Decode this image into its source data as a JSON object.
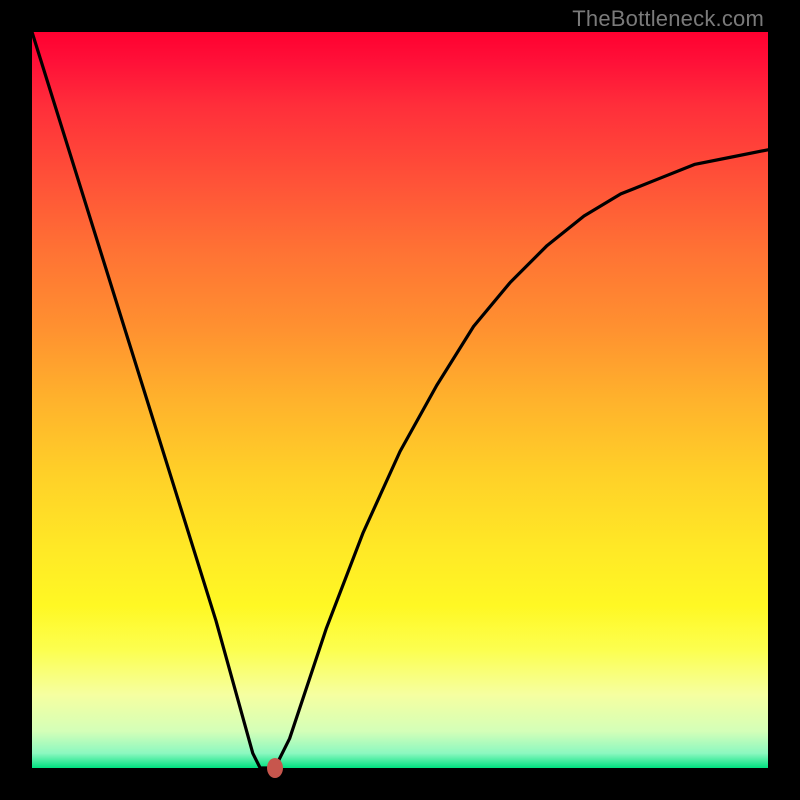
{
  "watermark": "TheBottleneck.com",
  "chart_data": {
    "type": "line",
    "title": "",
    "xlabel": "",
    "ylabel": "",
    "x": [
      0.0,
      0.05,
      0.1,
      0.15,
      0.2,
      0.25,
      0.3,
      0.31,
      0.33,
      0.35,
      0.4,
      0.45,
      0.5,
      0.55,
      0.6,
      0.65,
      0.7,
      0.75,
      0.8,
      0.85,
      0.9,
      0.95,
      1.0
    ],
    "values": [
      1.0,
      0.84,
      0.68,
      0.52,
      0.36,
      0.2,
      0.02,
      0.0,
      0.0,
      0.04,
      0.19,
      0.32,
      0.43,
      0.52,
      0.6,
      0.66,
      0.71,
      0.75,
      0.78,
      0.8,
      0.82,
      0.83,
      0.84
    ],
    "xlim": [
      0,
      1
    ],
    "ylim": [
      0,
      1
    ],
    "marker": {
      "x": 0.33,
      "y": 0.0
    },
    "background_gradient": {
      "top": "#ff0030",
      "middle": "#ffe826",
      "bottom": "#00e080"
    }
  }
}
